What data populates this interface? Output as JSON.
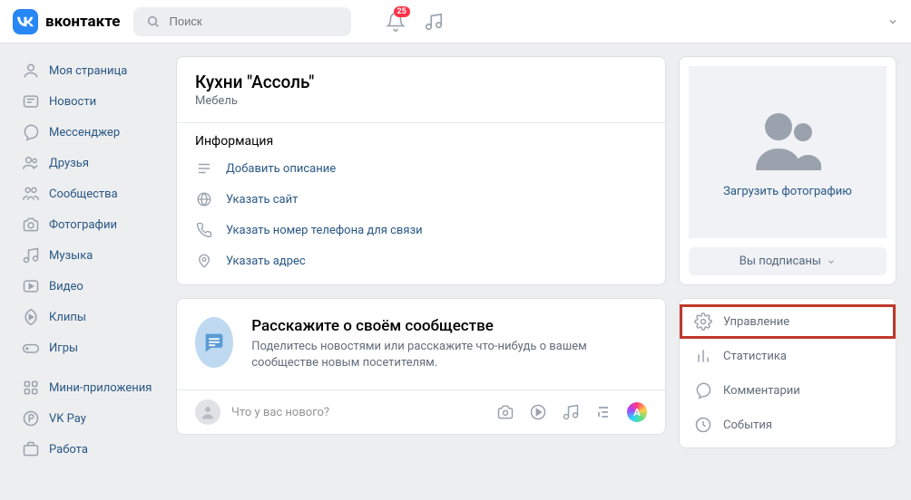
{
  "header": {
    "brand": "вконтакте",
    "search_placeholder": "Поиск",
    "notif_count": "25"
  },
  "sidebar": {
    "items": [
      {
        "label": "Моя страница"
      },
      {
        "label": "Новости"
      },
      {
        "label": "Мессенджер"
      },
      {
        "label": "Друзья"
      },
      {
        "label": "Сообщества"
      },
      {
        "label": "Фотографии"
      },
      {
        "label": "Музыка"
      },
      {
        "label": "Видео"
      },
      {
        "label": "Клипы"
      },
      {
        "label": "Игры"
      }
    ],
    "items2": [
      {
        "label": "Мини-приложения"
      },
      {
        "label": "VK Pay"
      },
      {
        "label": "Работа"
      }
    ]
  },
  "profile": {
    "title": "Кухни \"Ассоль\"",
    "category": "Мебель",
    "info_label": "Информация",
    "info_items": [
      {
        "label": "Добавить описание"
      },
      {
        "label": "Указать сайт"
      },
      {
        "label": "Указать номер телефона для связи"
      },
      {
        "label": "Указать адрес"
      }
    ]
  },
  "about": {
    "title": "Расскажите о своём сообществе",
    "desc": "Поделитесь новостями или расскажите что-нибудь о вашем сообществе новым посетителям."
  },
  "poster": {
    "placeholder": "Что у вас нового?",
    "avatar_letter": "A"
  },
  "right": {
    "upload_label": "Загрузить фотографию",
    "subscribed_label": "Вы подписаны",
    "mgmt": [
      {
        "label": "Управление"
      },
      {
        "label": "Статистика"
      },
      {
        "label": "Комментарии"
      },
      {
        "label": "События"
      }
    ]
  }
}
